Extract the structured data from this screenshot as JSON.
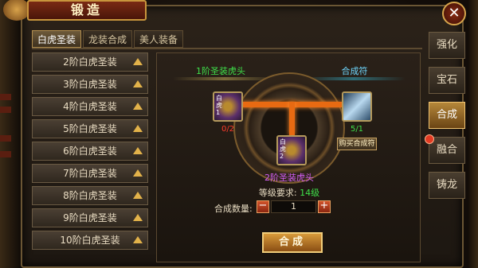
{
  "window": {
    "title": "锻造",
    "close_symbol": "✕"
  },
  "top_tabs": [
    {
      "label": "白虎圣装",
      "active": true
    },
    {
      "label": "龙装合成",
      "active": false
    },
    {
      "label": "美人装备",
      "active": false
    }
  ],
  "recipes": [
    "2阶白虎圣装",
    "3阶白虎圣装",
    "4阶白虎圣装",
    "5阶白虎圣装",
    "6阶白虎圣装",
    "7阶白虎圣装",
    "8阶白虎圣装",
    "9阶白虎圣装",
    "10阶白虎圣装"
  ],
  "synthesis": {
    "material_name": "1阶圣装虎头",
    "material_badge": "白虎1",
    "material_count": "0/2",
    "catalyst_name": "合成符",
    "catalyst_count": "5/1",
    "buy_label": "购买合成符",
    "result_name": "2阶圣装虎头",
    "result_badge": "白虎2",
    "level_label": "等级要求:",
    "level_value": "14级",
    "qty_label": "合成数量:",
    "qty_value": "1",
    "minus_symbol": "−",
    "plus_symbol": "+",
    "confirm_label": "合成"
  },
  "side_tabs": [
    {
      "label": "强化",
      "active": false
    },
    {
      "label": "宝石",
      "active": false
    },
    {
      "label": "合成",
      "active": true
    },
    {
      "label": "融合",
      "active": false
    },
    {
      "label": "铸龙",
      "active": false
    }
  ],
  "colors": {
    "green_text": "#3fe04a",
    "cyan_text": "#6fd8ff",
    "purple_text": "#d35ef5",
    "red_count": "#ff3a2a",
    "accent_orange": "#e86a12"
  }
}
